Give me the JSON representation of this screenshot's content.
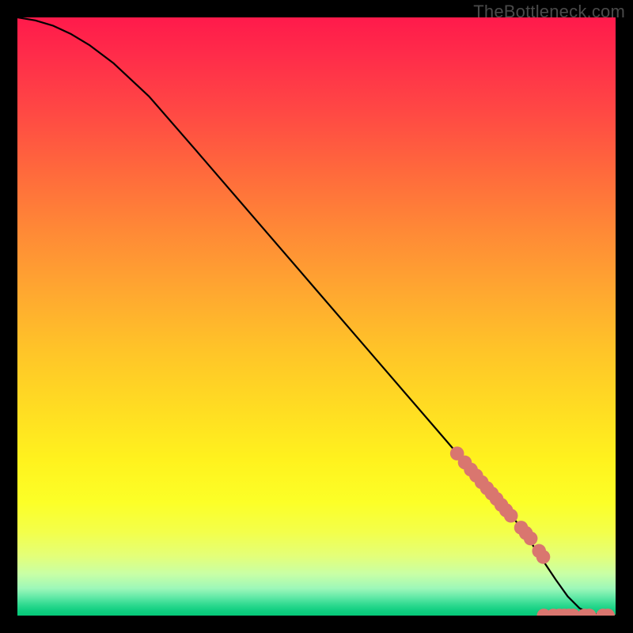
{
  "watermark": "TheBottleneck.com",
  "colors": {
    "curve_stroke": "#000000",
    "marker_fill": "#d9766f",
    "marker_stroke": "#b05a54",
    "background": "#000000"
  },
  "chart_data": {
    "type": "line",
    "title": "",
    "xlabel": "",
    "ylabel": "",
    "xlim": [
      0,
      100
    ],
    "ylim": [
      0,
      100
    ],
    "grid": false,
    "legend": false,
    "curve": {
      "name": "bottleneck-curve",
      "x": [
        0,
        3,
        6,
        9,
        12,
        16,
        22,
        30,
        40,
        50,
        60,
        70,
        78,
        84,
        86,
        88,
        90,
        92,
        94,
        96,
        98,
        100
      ],
      "y": [
        100,
        99.5,
        98.6,
        97.2,
        95.4,
        92.4,
        86.8,
        77.6,
        66.0,
        54.4,
        42.8,
        31.2,
        21.9,
        15.0,
        12.0,
        9.0,
        6.0,
        3.2,
        1.2,
        0.3,
        0.05,
        0.0
      ]
    },
    "markers": {
      "name": "highlighted-points",
      "x": [
        73.5,
        74.8,
        75.8,
        76.7,
        77.6,
        78.5,
        79.3,
        80.1,
        80.9,
        81.7,
        82.5,
        84.2,
        85.0,
        85.8,
        87.2,
        87.9,
        88.0,
        89.6,
        90.6,
        91.4,
        92.2,
        92.9,
        94.8,
        95.6,
        97.9,
        98.7
      ],
      "y": [
        27.1,
        25.6,
        24.4,
        23.4,
        22.3,
        21.3,
        20.4,
        19.5,
        18.5,
        17.6,
        16.7,
        14.7,
        13.8,
        12.9,
        10.8,
        9.8,
        0.0,
        0.0,
        0.0,
        0.0,
        0.0,
        0.0,
        0.0,
        0.0,
        0.0,
        0.0
      ]
    }
  }
}
